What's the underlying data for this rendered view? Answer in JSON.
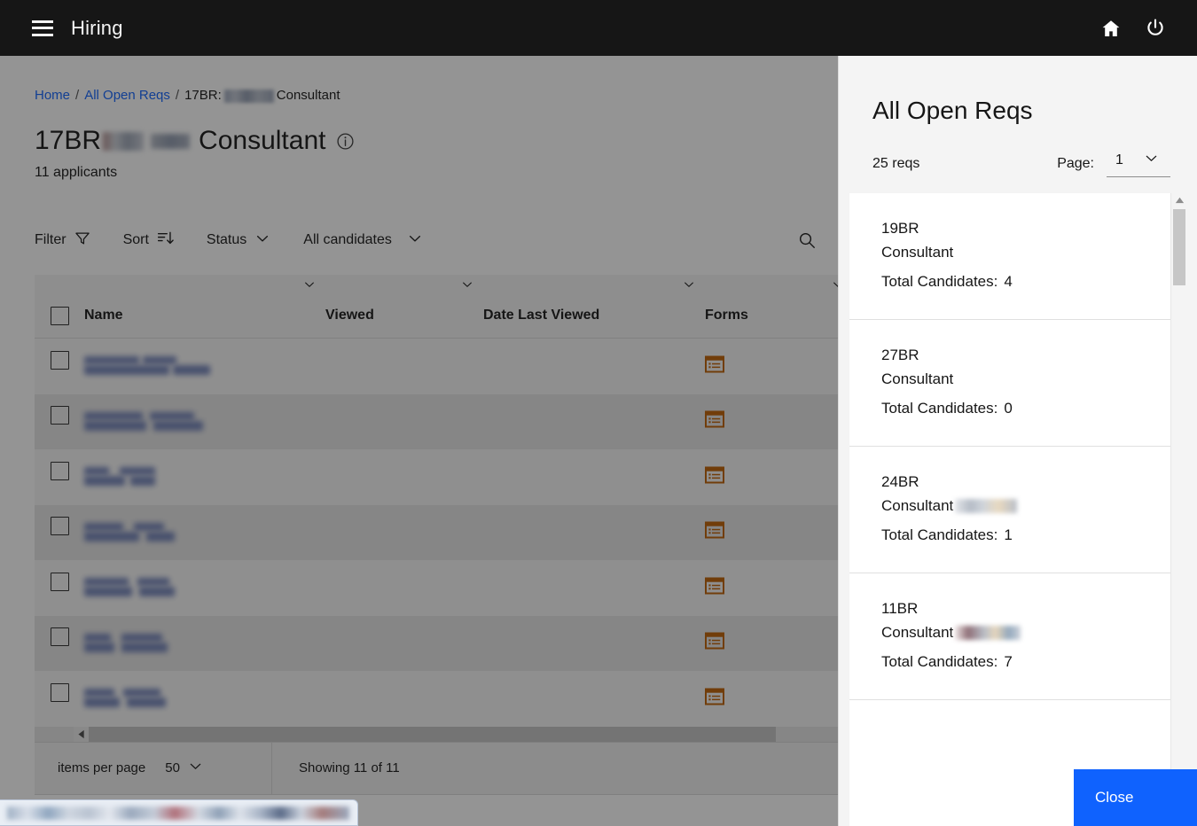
{
  "topbar": {
    "app_title": "Hiring",
    "menu_icon": "hamburger-menu-icon",
    "home_icon": "home-icon",
    "power_icon": "power-icon"
  },
  "breadcrumb": {
    "home": "Home",
    "all_open_reqs": "All Open Reqs",
    "current_prefix": "17BR:",
    "current_suffix": "Consultant",
    "separator": "/"
  },
  "header": {
    "title_prefix": "17BR",
    "title_suffix": "Consultant",
    "info_icon": "info-icon",
    "applicants": "11 applicants"
  },
  "toolbar": {
    "filter_label": "Filter",
    "filter_icon": "filter-funnel-icon",
    "sort_label": "Sort",
    "sort_icon": "sort-descending-icon",
    "status_label": "Status",
    "status_icon": "chevron-down-icon",
    "candidates_label": "All candidates",
    "candidates_icon": "chevron-down-icon",
    "search_icon": "search-icon"
  },
  "table": {
    "columns": [
      "Name",
      "Viewed",
      "Date Last Viewed",
      "Forms"
    ],
    "select_all_label": "select-all-checkbox",
    "row_count": 7,
    "form_icon": "form-list-icon",
    "sort_caret": "chevron-down-icon"
  },
  "footer": {
    "items_per_page_label": "items per page",
    "items_per_page_value": "50",
    "items_per_page_icon": "chevron-down-icon",
    "showing": "Showing 11 of 11"
  },
  "panel": {
    "title": "All Open Reqs",
    "reqs_count": "25 reqs",
    "page_label": "Page:",
    "page_value": "1",
    "page_icon": "chevron-down-icon",
    "close_label": "Close",
    "scroll_up_icon": "triangle-up-icon",
    "scroll_down_icon": "triangle-down-icon",
    "cards": [
      {
        "req_id": "19BR",
        "role": "Consultant",
        "role_redacted": false,
        "candidates_label": "Total Candidates:",
        "candidates": "4"
      },
      {
        "req_id": "27BR",
        "role": "Consultant",
        "role_redacted": false,
        "candidates_label": "Total Candidates:",
        "candidates": "0"
      },
      {
        "req_id": "24BR",
        "role": "Consultant",
        "role_redacted": true,
        "candidates_label": "Total Candidates:",
        "candidates": "1"
      },
      {
        "req_id": "11BR",
        "role": "Consultant",
        "role_redacted": true,
        "candidates_label": "Total Candidates:",
        "candidates": "7"
      }
    ]
  },
  "colors": {
    "topbar_bg": "#161616",
    "accent_blue": "#0f62fe",
    "link_blue": "#0f62fe",
    "form_icon_orange": "#bf5f00",
    "panel_bg": "#f4f4f4",
    "card_bg": "#ffffff"
  }
}
